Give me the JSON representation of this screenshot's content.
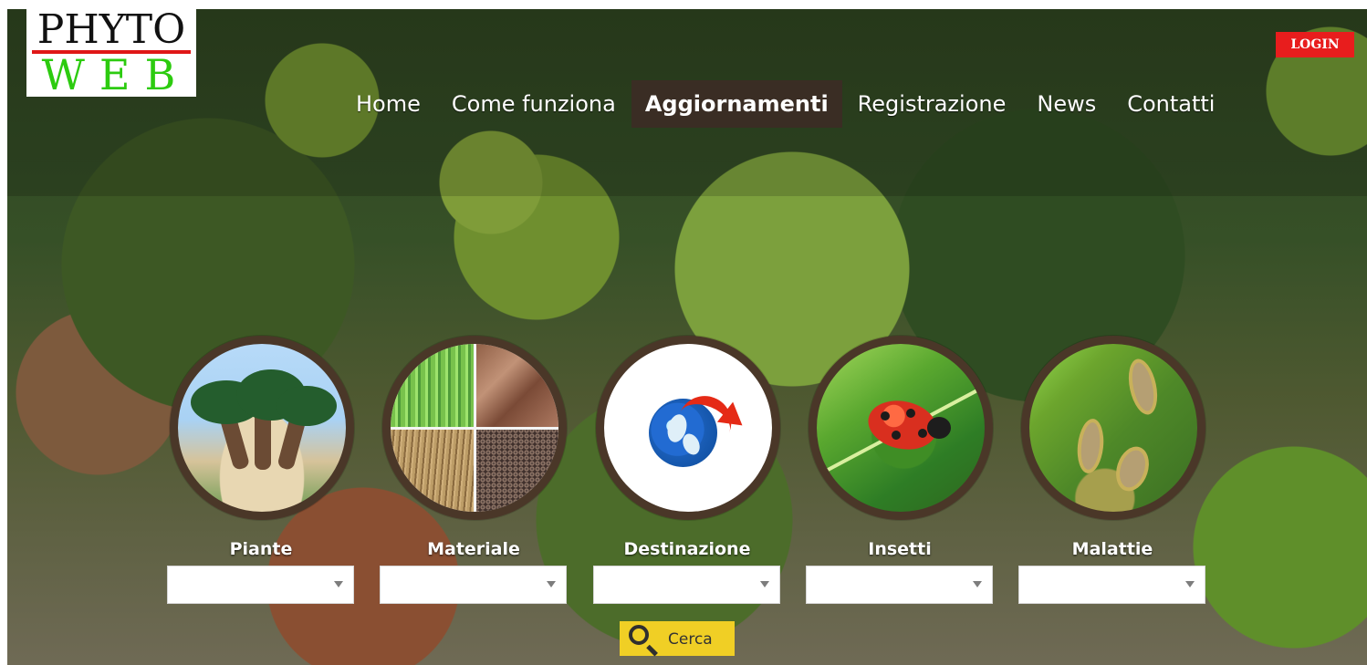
{
  "brand": {
    "logo_top": "PHYTO",
    "logo_bottom": "WEB"
  },
  "header": {
    "login_label": "LOGIN"
  },
  "nav": {
    "items": [
      {
        "label": "Home",
        "active": false
      },
      {
        "label": "Come funziona",
        "active": false
      },
      {
        "label": "Aggiornamenti",
        "active": true
      },
      {
        "label": "Registrazione",
        "active": false
      },
      {
        "label": "News",
        "active": false
      },
      {
        "label": "Contatti",
        "active": false
      }
    ]
  },
  "categories": [
    {
      "label": "Piante",
      "icon": "palm-plants-image",
      "selected": ""
    },
    {
      "label": "Materiale",
      "icon": "material-samples-image",
      "selected": ""
    },
    {
      "label": "Destinazione",
      "icon": "globe-destination-image",
      "selected": ""
    },
    {
      "label": "Insetti",
      "icon": "ladybug-image",
      "selected": ""
    },
    {
      "label": "Malattie",
      "icon": "diseased-leaf-image",
      "selected": ""
    }
  ],
  "search": {
    "label": "Cerca",
    "icon": "search-icon"
  },
  "colors": {
    "login_red": "#e81d1d",
    "active_nav": "#3a2d24",
    "logo_green": "#2ccb0f",
    "logo_rule": "#e01717",
    "search_yellow": "#f0cf25"
  }
}
